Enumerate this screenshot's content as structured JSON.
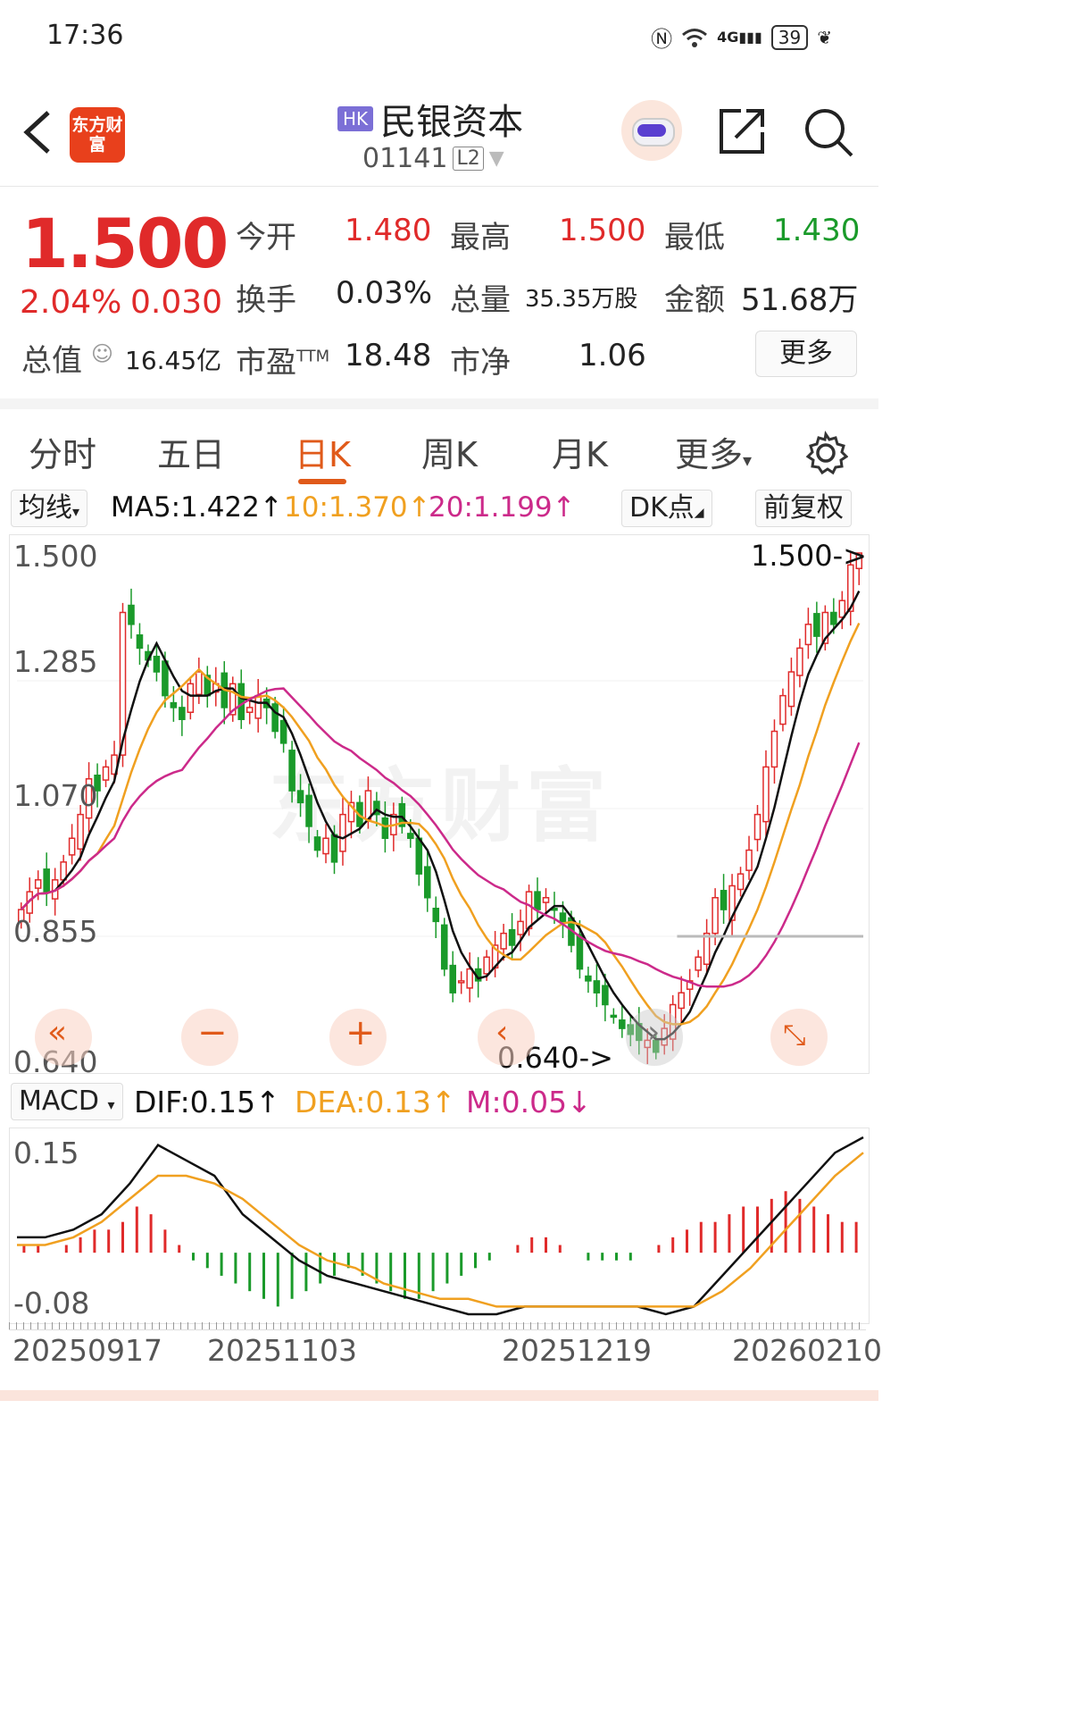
{
  "status_bar": {
    "time": "17:36",
    "icons": [
      "nfc-icon",
      "wifi-icon",
      "4g-signal-icon"
    ],
    "network": "4G",
    "battery": "39"
  },
  "header": {
    "back_icon": "chevron-left-icon",
    "brand_logo_text": "东方财富",
    "market_badge": "HK",
    "stock_name": "民银资本",
    "stock_code": "01141",
    "level_badge": "L2",
    "icons": [
      "robot-avatar-icon",
      "share-icon",
      "search-icon"
    ]
  },
  "quote": {
    "price": "1.500",
    "change_pct": "2.04%",
    "change_abs": "0.030",
    "open_label": "今开",
    "open": "1.480",
    "high_label": "最高",
    "high": "1.500",
    "low_label": "最低",
    "low": "1.430",
    "turnover_label": "换手",
    "turnover": "0.03%",
    "volume_label": "总量",
    "volume": "35.35万股",
    "amount_label": "金额",
    "amount": "51.68万",
    "mktcap_label": "总值",
    "mktcap": "16.45亿",
    "pe_label": "市盈",
    "pe_sup": "TTM",
    "pe": "18.48",
    "pb_label": "市净",
    "pb": "1.06",
    "more_button": "更多"
  },
  "tabs": [
    "分时",
    "五日",
    "日K",
    "周K",
    "月K",
    "更多"
  ],
  "active_tab": "日K",
  "ma_bar": {
    "selector": "均线",
    "ma5": "MA5:1.422↑",
    "ma10": "10:1.370↑",
    "ma20": "20:1.199↑",
    "dk_button": "DK点",
    "adjust_button": "前复权"
  },
  "kline_axis": {
    "labels": [
      "1.500",
      "1.285",
      "1.070",
      "0.855",
      "0.640"
    ],
    "max_marker": "1.500->",
    "min_marker": "0.640->"
  },
  "watermark": "东方财富",
  "macd_bar": {
    "selector": "MACD",
    "dif": "DIF:0.15↑",
    "dea": "DEA:0.13↑",
    "m": "M:0.05↓"
  },
  "macd_axis": {
    "labels": [
      "0.15",
      "-0.08"
    ]
  },
  "date_labels": [
    "20250917",
    "20251103",
    "20251219",
    "20260210"
  ],
  "colors": {
    "up": "#e02a2a",
    "down": "#1a9a2a",
    "ma5": "#111111",
    "ma10": "#f0a020",
    "ma20": "#cc2a8a",
    "accent": "#e05a1a"
  },
  "chart_data": [
    {
      "type": "candlestick",
      "ylim": [
        0.64,
        1.5
      ],
      "x_labels": [
        "20250917",
        "20251103",
        "20251219",
        "20260210"
      ],
      "close_series": [
        0.9,
        0.93,
        0.95,
        0.93,
        0.95,
        0.98,
        1.02,
        1.06,
        1.12,
        1.1,
        1.14,
        1.16,
        1.4,
        1.38,
        1.34,
        1.32,
        1.3,
        1.26,
        1.24,
        1.22,
        1.28,
        1.3,
        1.26,
        1.28,
        1.24,
        1.28,
        1.22,
        1.24,
        1.26,
        1.24,
        1.2,
        1.18,
        1.1,
        1.08,
        1.04,
        1.0,
        1.02,
        0.98,
        1.06,
        1.08,
        1.04,
        1.1,
        1.06,
        1.02,
        1.06,
        1.04,
        1.02,
        0.96,
        0.92,
        0.88,
        0.8,
        0.76,
        0.78,
        0.8,
        0.78,
        0.82,
        0.84,
        0.86,
        0.84,
        0.88,
        0.93,
        0.9,
        0.92,
        0.9,
        0.88,
        0.84,
        0.8,
        0.78,
        0.76,
        0.74,
        0.72,
        0.7,
        0.69,
        0.68,
        0.68,
        0.66,
        0.7,
        0.74,
        0.76,
        0.78,
        0.82,
        0.86,
        0.92,
        0.9,
        0.94,
        0.96,
        1.0,
        1.06,
        1.14,
        1.2,
        1.26,
        1.3,
        1.34,
        1.38,
        1.36,
        1.4,
        1.38,
        1.42,
        1.48,
        1.5
      ],
      "ma_values": {
        "MA5": 1.422,
        "MA10": 1.37,
        "MA20": 1.199
      },
      "last_close": 1.5,
      "max_marker": 1.5,
      "min_marker": 0.64
    },
    {
      "type": "bar",
      "title": "MACD",
      "ylim": [
        -0.08,
        0.15
      ],
      "hist": [
        0.01,
        0.01,
        0.0,
        0.01,
        0.02,
        0.03,
        0.03,
        0.04,
        0.06,
        0.05,
        0.03,
        0.01,
        -0.01,
        -0.02,
        -0.03,
        -0.04,
        -0.05,
        -0.06,
        -0.07,
        -0.06,
        -0.05,
        -0.04,
        -0.03,
        -0.02,
        -0.03,
        -0.04,
        -0.05,
        -0.06,
        -0.06,
        -0.05,
        -0.04,
        -0.03,
        -0.02,
        -0.01,
        0.0,
        0.01,
        0.02,
        0.02,
        0.01,
        0.0,
        -0.01,
        -0.01,
        -0.01,
        -0.01,
        0.0,
        0.01,
        0.02,
        0.03,
        0.04,
        0.04,
        0.05,
        0.06,
        0.06,
        0.07,
        0.08,
        0.07,
        0.06,
        0.05,
        0.04,
        0.04
      ],
      "dif": [
        0.02,
        0.02,
        0.03,
        0.05,
        0.09,
        0.14,
        0.12,
        0.1,
        0.05,
        0.02,
        -0.01,
        -0.03,
        -0.04,
        -0.05,
        -0.06,
        -0.07,
        -0.08,
        -0.08,
        -0.07,
        -0.07,
        -0.07,
        -0.07,
        -0.07,
        -0.08,
        -0.07,
        -0.03,
        0.01,
        0.05,
        0.09,
        0.13,
        0.15
      ],
      "dea": [
        0.01,
        0.01,
        0.02,
        0.04,
        0.07,
        0.1,
        0.1,
        0.09,
        0.07,
        0.04,
        0.01,
        -0.01,
        -0.02,
        -0.04,
        -0.05,
        -0.06,
        -0.06,
        -0.07,
        -0.07,
        -0.07,
        -0.07,
        -0.07,
        -0.07,
        -0.07,
        -0.07,
        -0.05,
        -0.02,
        0.02,
        0.06,
        0.1,
        0.13
      ]
    }
  ]
}
